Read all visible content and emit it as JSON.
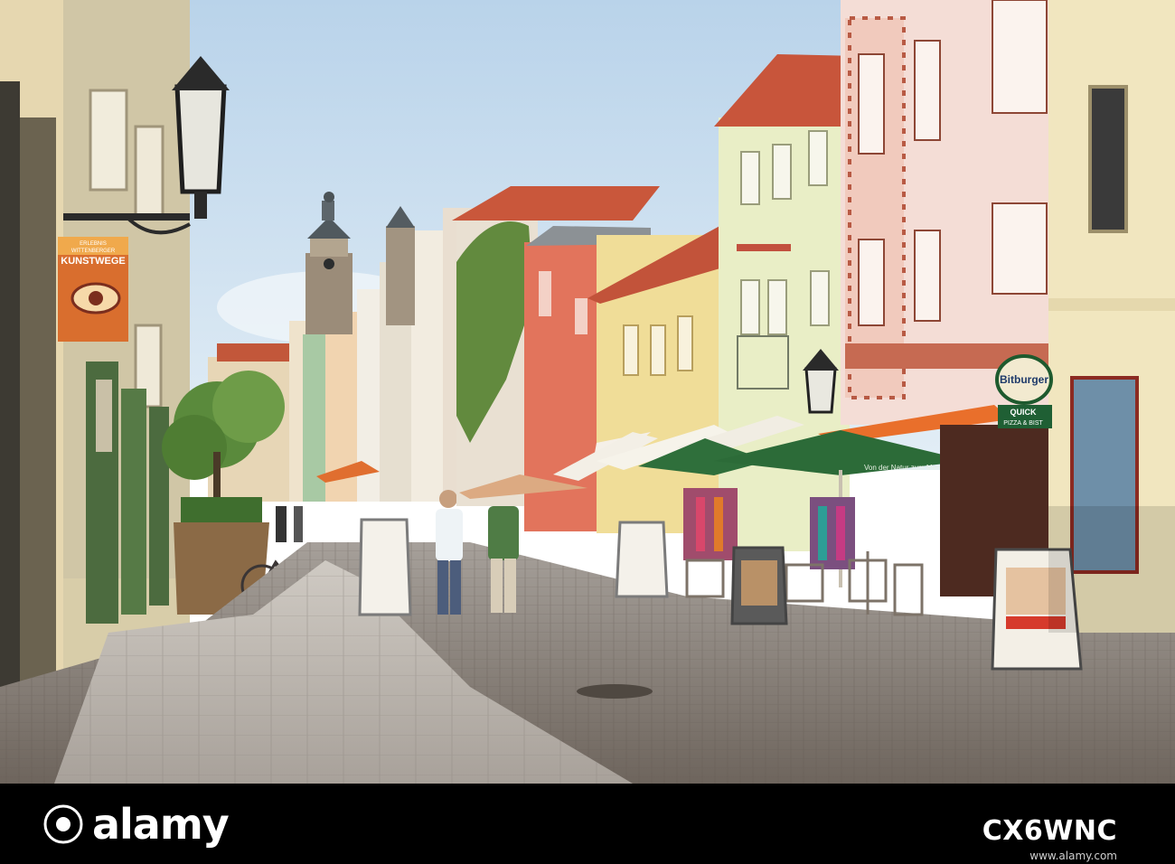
{
  "scene": {
    "sign_top_line": "ERLEBNIS",
    "sign_middle_line": "WITTENBERGER",
    "sign_main_word": "KUNSTWEGE",
    "shop_sign_quick": "QUICK",
    "shop_sign_pizza": "PIZZA & BIST",
    "umbrella_slogan": "Von der Natur zum Menschen",
    "beer_sign": "Bitburger"
  },
  "watermark": {
    "brand": "alamy",
    "image_id": "CX6WNC",
    "site": "www.alamy.com"
  }
}
